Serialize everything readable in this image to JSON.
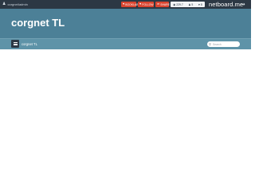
{
  "topbar": {
    "user_label": "corgnet/admin",
    "user_icon": "user-icon",
    "buttons": [
      {
        "label": "BOOKLAB",
        "icon": "heart-icon"
      },
      {
        "label": "FOLLOW",
        "icon": "heart-icon"
      },
      {
        "label": "SHARE",
        "icon": "share-icon"
      }
    ],
    "stats": [
      {
        "icon": "eye-icon",
        "value": "229.7"
      },
      {
        "icon": "users-icon",
        "value": "5"
      },
      {
        "icon": "heart-icon",
        "value": "8"
      }
    ],
    "brand": "netboard.me",
    "exit_icon": "sign-out-icon"
  },
  "header": {
    "title": "corgnet TL"
  },
  "navbar": {
    "menu_icon": "hamburger-icon",
    "breadcrumb": "corgnet TL",
    "search_placeholder": "Search"
  },
  "colors": {
    "topbar": "#2c3844",
    "header": "#4c8097",
    "navbar": "#5e93a8",
    "accent_button": "#d9442f"
  }
}
